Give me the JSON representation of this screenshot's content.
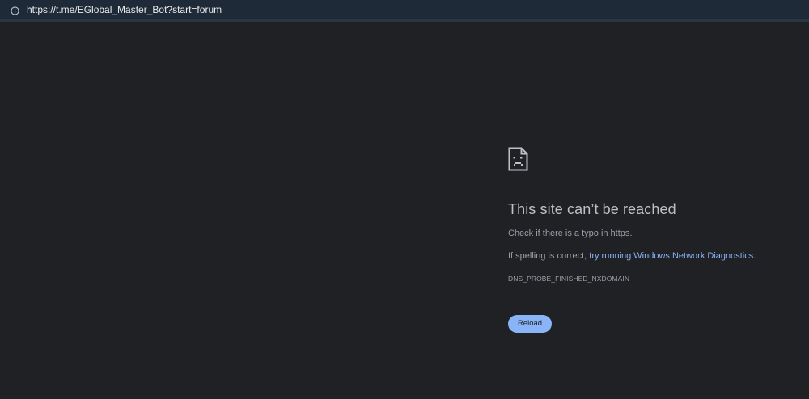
{
  "address_bar": {
    "url": "https://t.me/EGlobal_Master_Bot?start=forum",
    "info_icon": "info-circle-icon"
  },
  "error_page": {
    "icon": "sad-page-icon",
    "heading": "This site can’t be reached",
    "line1": "Check if there is a typo in https.",
    "line2_prefix": "If spelling is correct, ",
    "line2_link": "try running Windows Network Diagnostics",
    "line2_suffix": ".",
    "error_code": "DNS_PROBE_FINISHED_NXDOMAIN",
    "reload_label": "Reload"
  },
  "colors": {
    "page_background": "#202124",
    "address_bar_background": "#1f2a38",
    "heading": "#bdc1c6",
    "body_text": "#9aa0a6",
    "link": "#8ab4f8",
    "button": "#8ab4f8"
  }
}
